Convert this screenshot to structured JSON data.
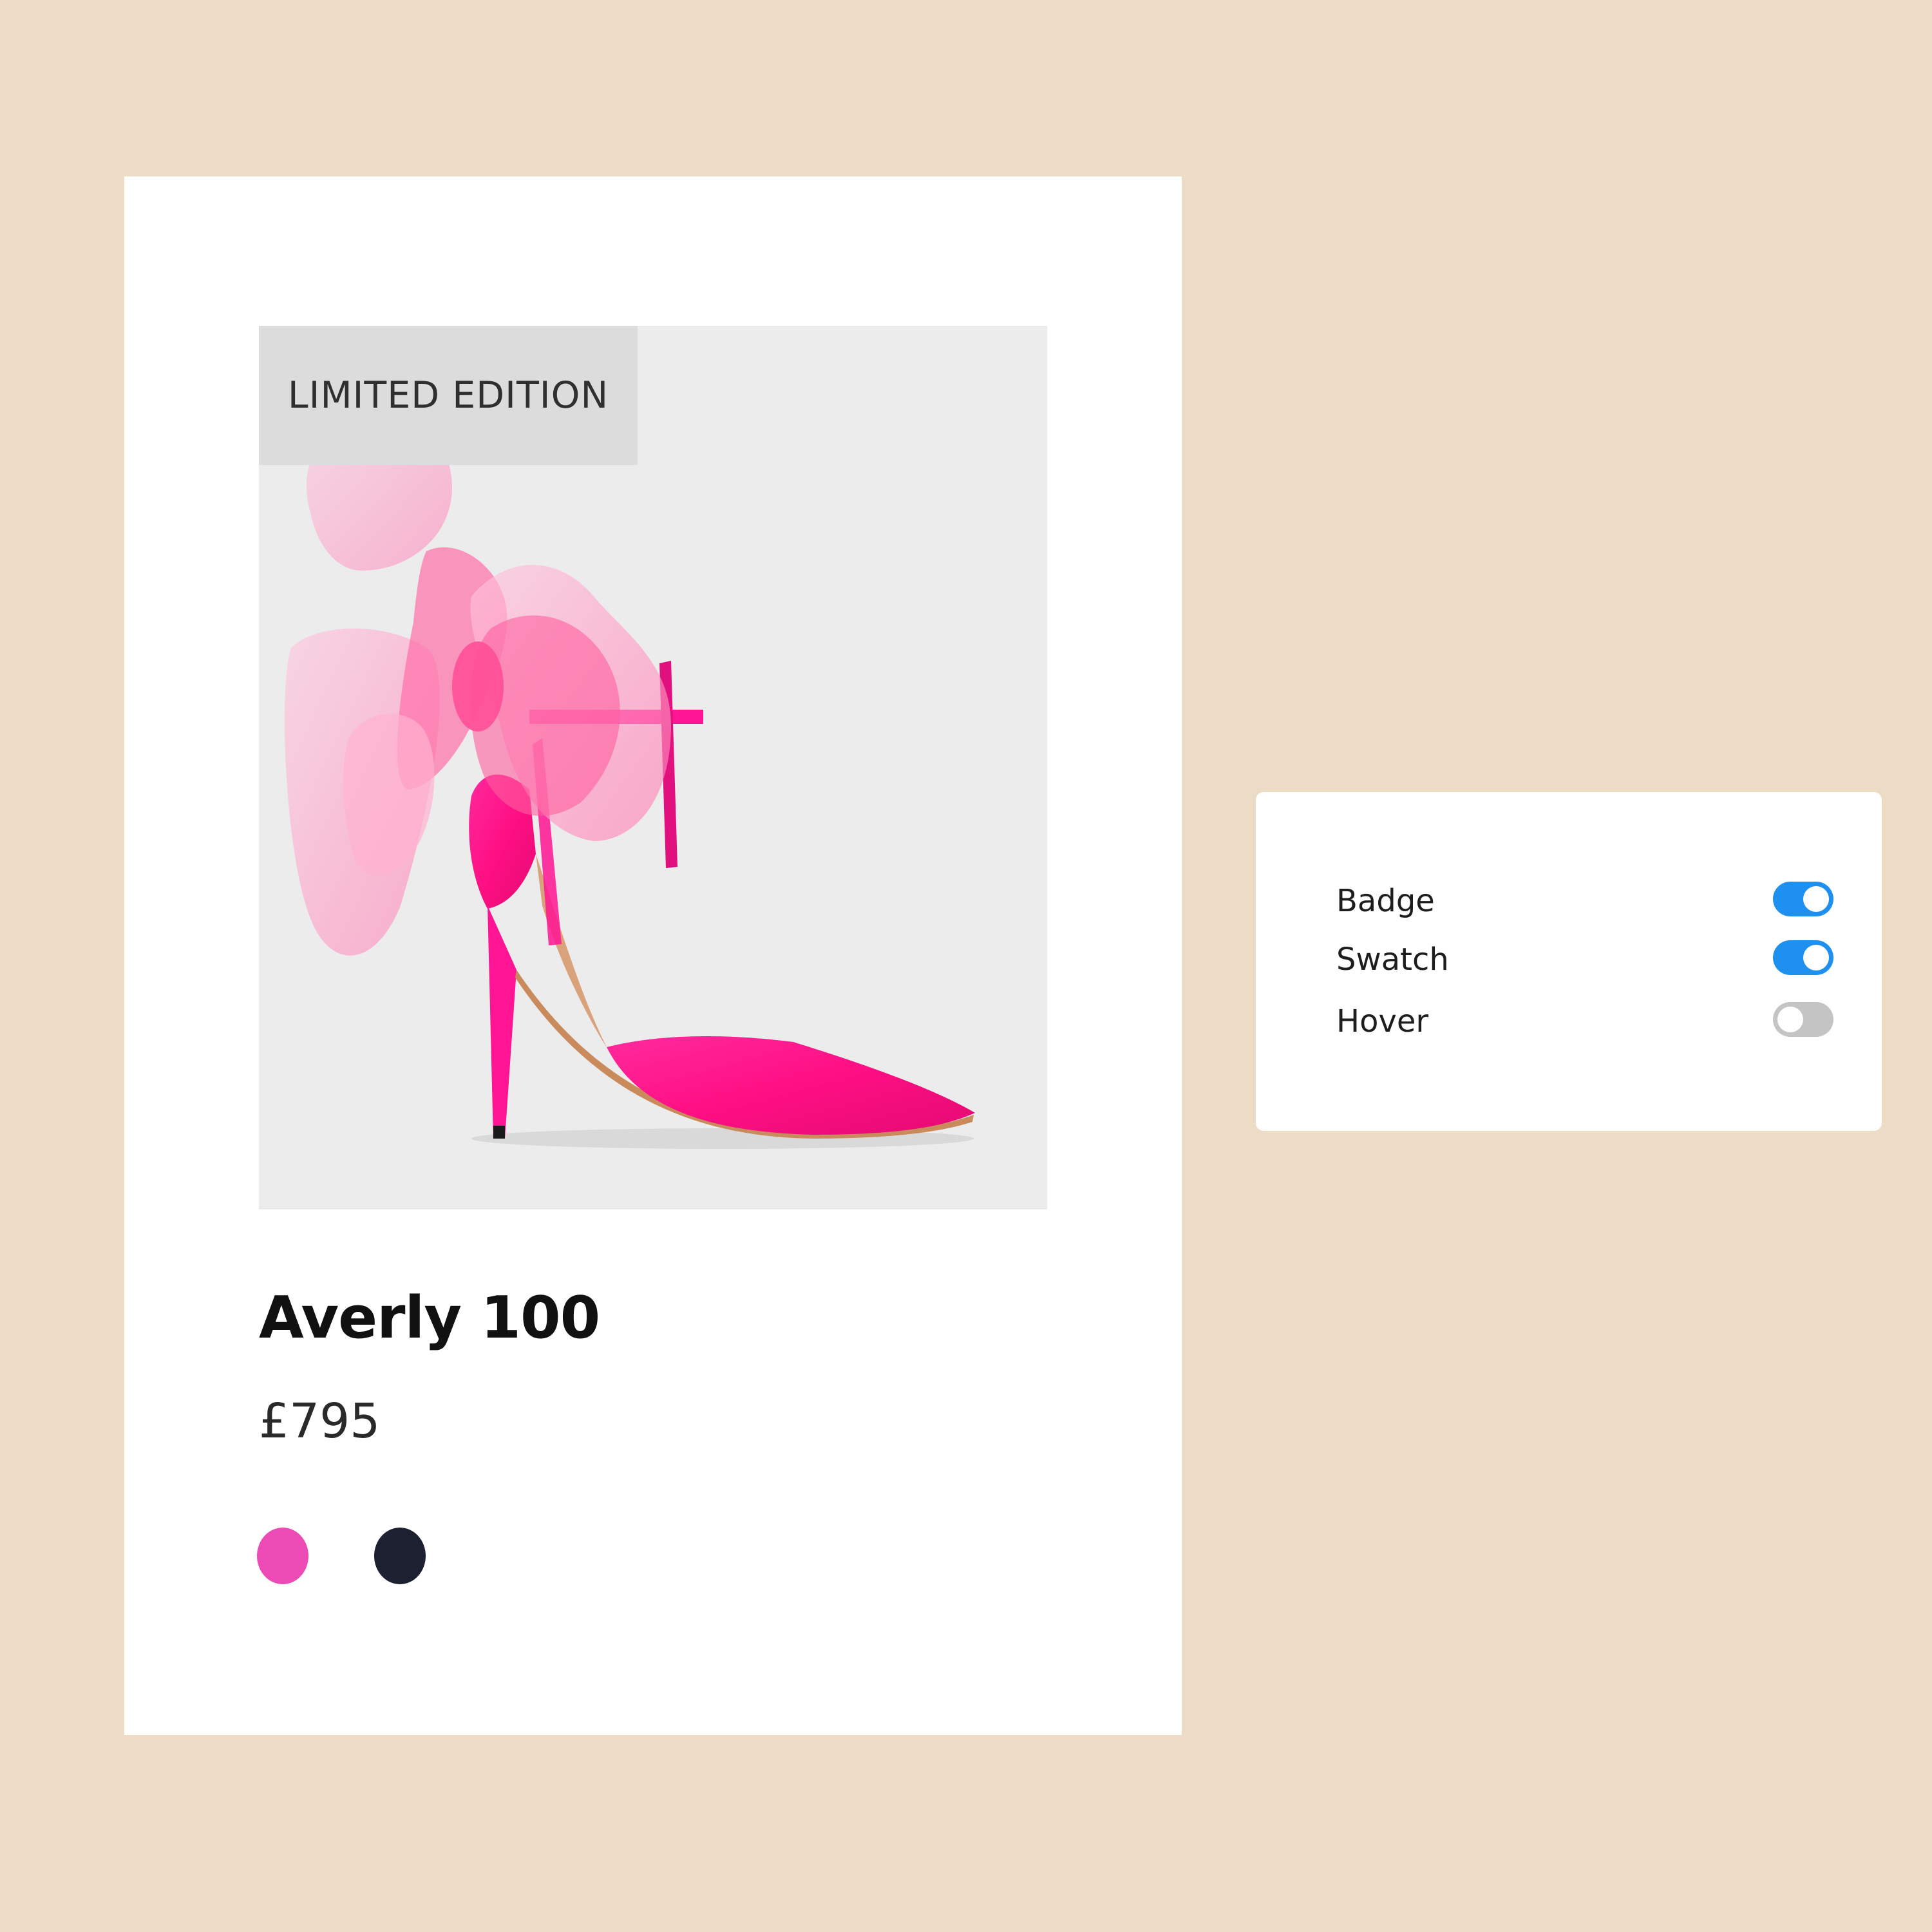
{
  "product_card": {
    "badge": "LIMITED EDITION",
    "name": "Averly 100",
    "price": "£795",
    "image": "pink-stiletto-pump-with-tulle-bow",
    "swatches": [
      {
        "name": "pink",
        "color": "#ec4bb6"
      },
      {
        "name": "navy",
        "color": "#1d2030"
      }
    ]
  },
  "settings_panel": {
    "toggles": [
      {
        "label": "Badge",
        "state": "on"
      },
      {
        "label": "Swatch",
        "state": "on"
      },
      {
        "label": "Hover",
        "state": "off"
      }
    ]
  },
  "colors": {
    "background": "#ecdcc6",
    "toggle_on": "#1e90f0",
    "toggle_off": "#c4c4c4",
    "shoe": "#ff1493"
  }
}
